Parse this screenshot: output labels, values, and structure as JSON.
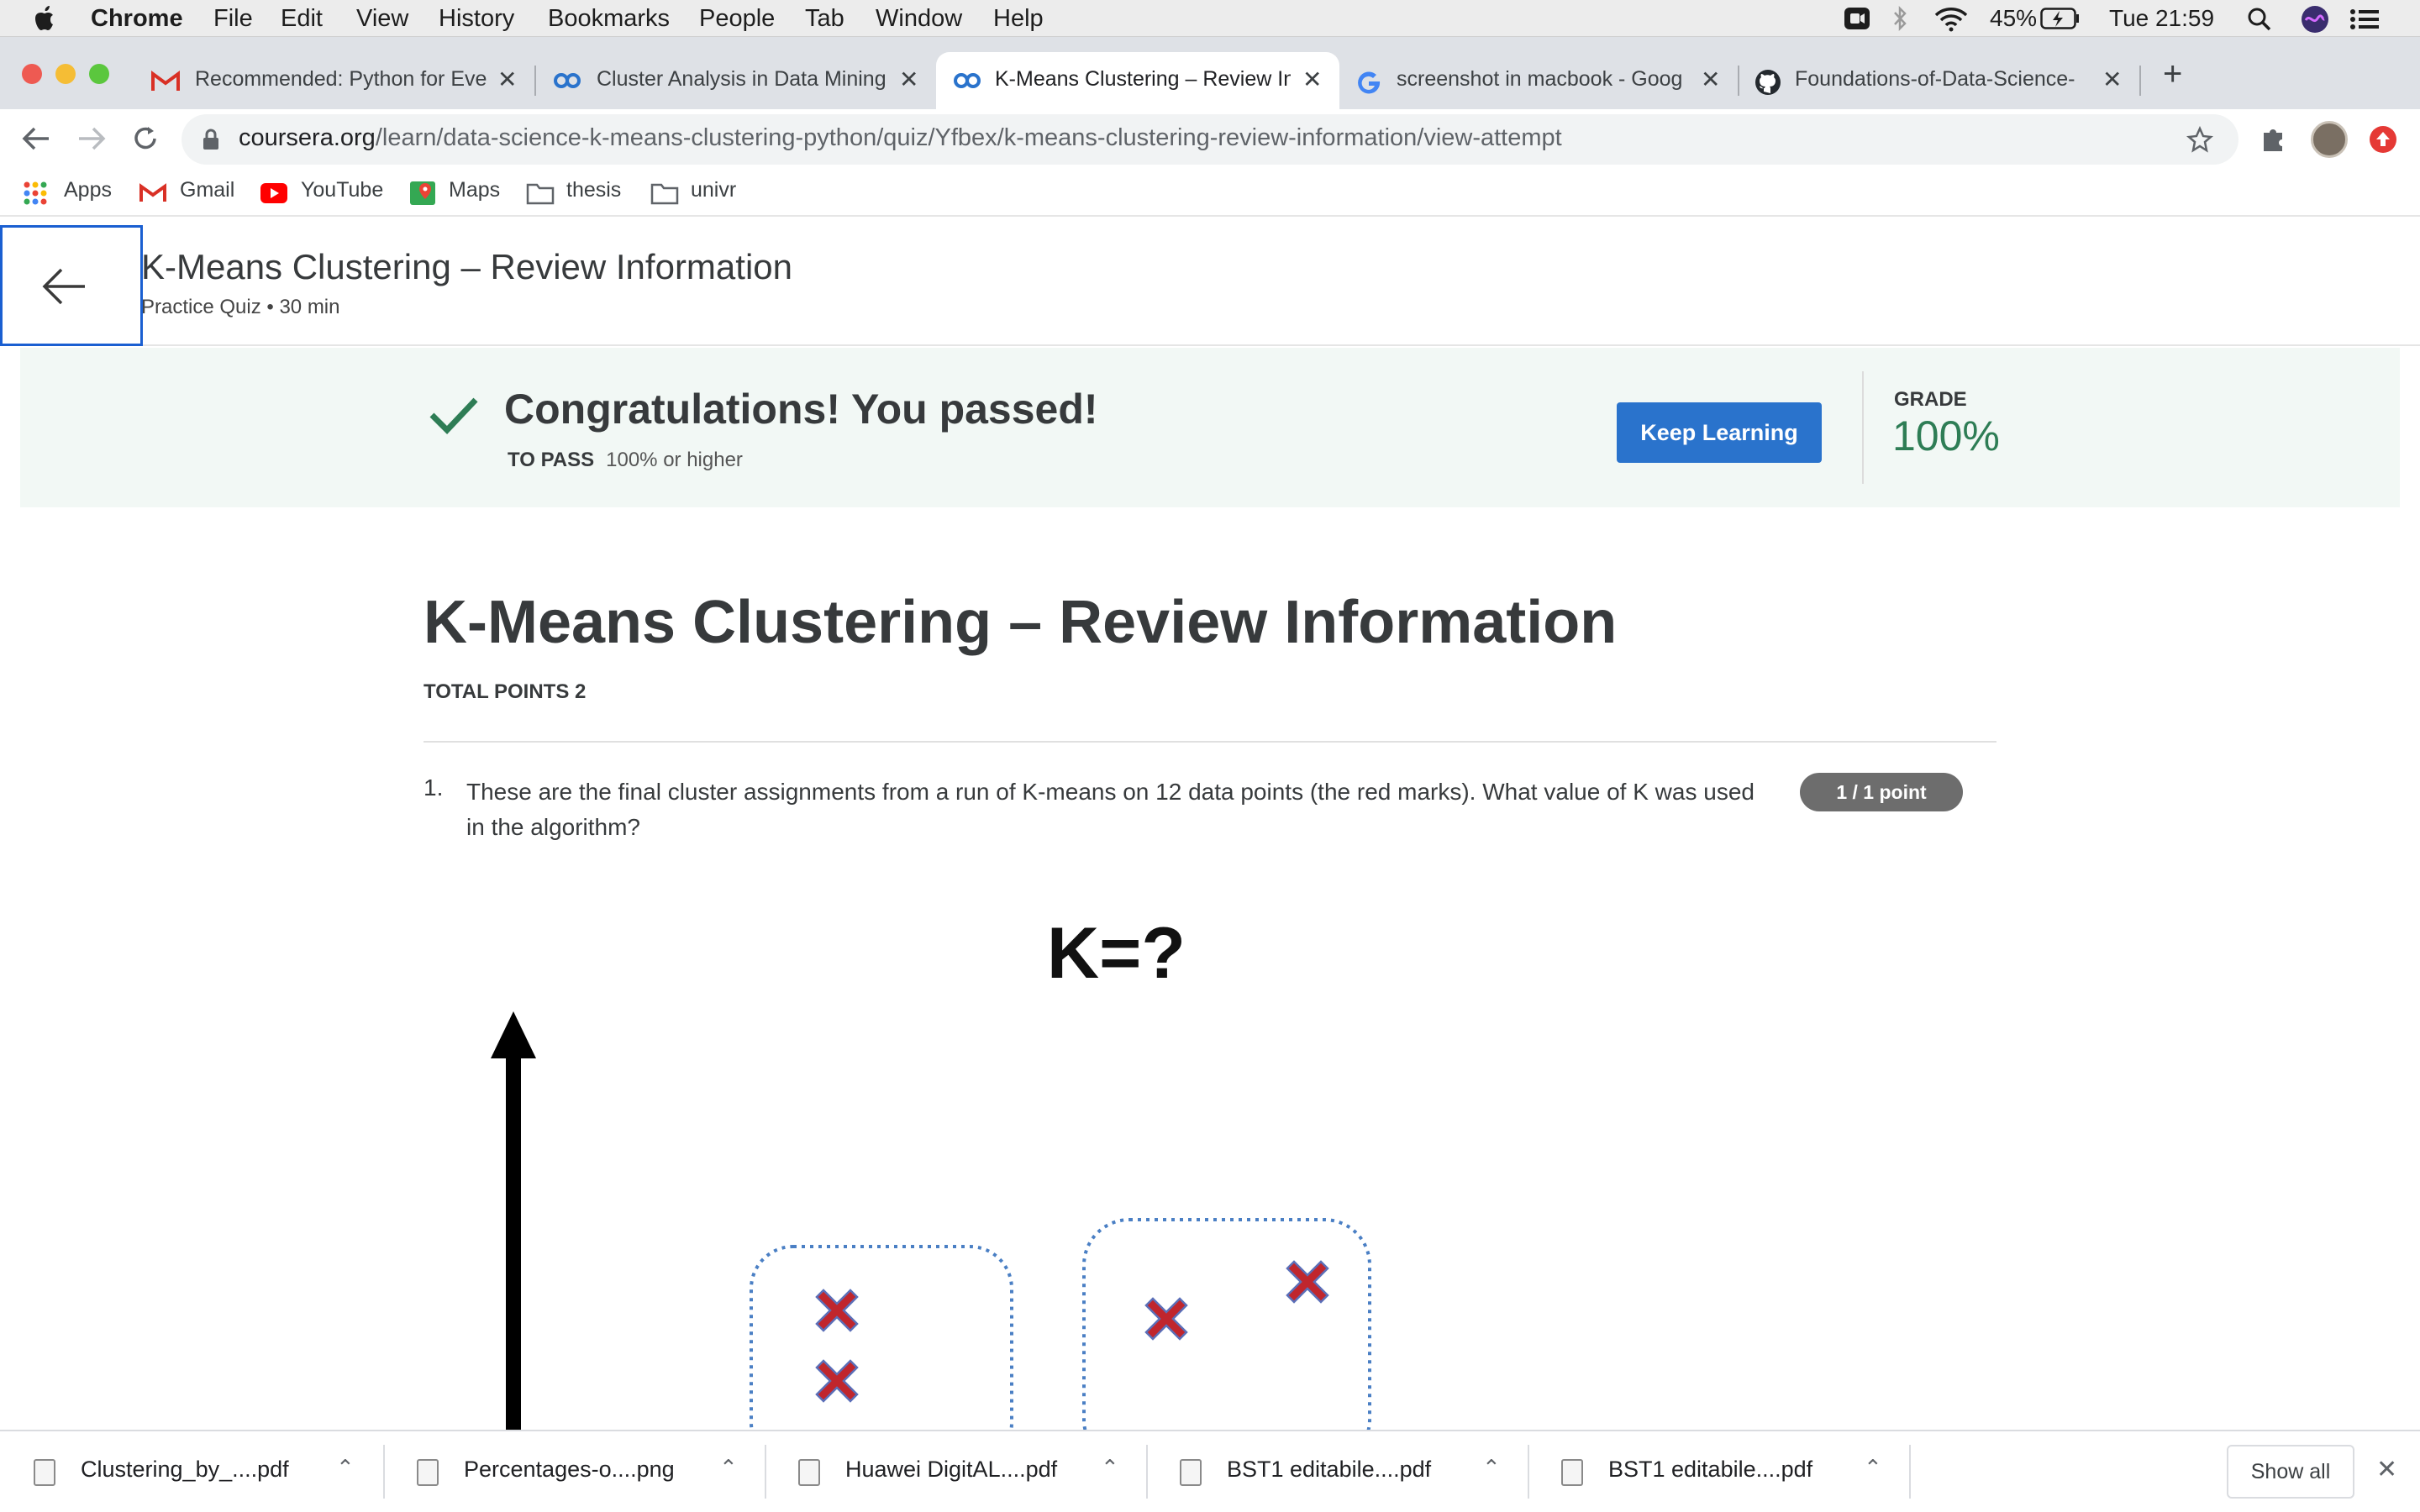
{
  "menubar": {
    "app": "Chrome",
    "items": [
      "File",
      "Edit",
      "View",
      "History",
      "Bookmarks",
      "People",
      "Tab",
      "Window",
      "Help"
    ],
    "battery": "45%",
    "clock": "Tue 21:59"
  },
  "tabs": [
    {
      "title": "Recommended: Python for Eve",
      "icon": "gmail-icon"
    },
    {
      "title": "Cluster Analysis in Data Mining",
      "icon": "coursera-icon"
    },
    {
      "title": "K-Means Clustering – Review In",
      "icon": "coursera-icon"
    },
    {
      "title": "screenshot in macbook - Goog",
      "icon": "google-icon"
    },
    {
      "title": "Foundations-of-Data-Science-",
      "icon": "github-icon"
    }
  ],
  "address": {
    "host": "coursera.org",
    "path": "/learn/data-science-k-means-clustering-python/quiz/Yfbex/k-means-clustering-review-information/view-attempt"
  },
  "bookmarks": [
    "Apps",
    "Gmail",
    "YouTube",
    "Maps",
    "thesis",
    "univr"
  ],
  "course_header": {
    "title": "K-Means Clustering – Review Information",
    "subtitle": "Practice Quiz • 30 min"
  },
  "banner": {
    "message": "Congratulations! You passed!",
    "to_pass_label": "TO PASS",
    "to_pass_value": "100% or higher",
    "button": "Keep Learning",
    "grade_label": "GRADE",
    "grade_value": "100%"
  },
  "quiz": {
    "title": "K-Means Clustering – Review Information",
    "total_points": "TOTAL POINTS 2",
    "question_number": "1.",
    "question_text": "These are the final cluster assignments from a run of K-means on 12 data points (the red marks). What value of K was used in the algorithm?",
    "points_badge": "1 / 1 point",
    "figure_label": "K=?"
  },
  "downloads": {
    "files": [
      "Clustering_by_....pdf",
      "Percentages-o....png",
      "Huawei DigitAL....pdf",
      "BST1 editabile....pdf",
      "BST1 editabile....pdf"
    ],
    "show_all": "Show all"
  },
  "colors": {
    "accent": "#2a73cc",
    "grade_green": "#2e7d55",
    "banner_bg": "#f2f8f5",
    "marker_red": "#c0262d"
  }
}
